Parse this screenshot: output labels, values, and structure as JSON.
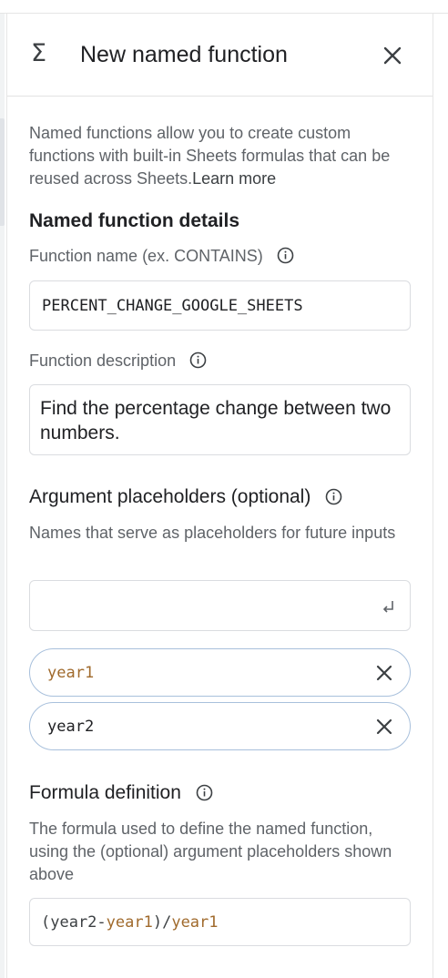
{
  "panel": {
    "title": "New named function",
    "intro_text": "Named functions allow you to create custom functions with built-in Sheets formulas that can be reused across Sheets.",
    "learn_more": "Learn more"
  },
  "details": {
    "section_title": "Named function details",
    "name_label": "Function name (ex. CONTAINS)",
    "name_value": "PERCENT_CHANGE_GOOGLE_SHEETS",
    "description_label": "Function description",
    "description_value": "Find the percentage change between two numbers."
  },
  "arguments": {
    "section_title": "Argument placeholders (optional)",
    "helper": "Names that serve as placeholders for future inputs",
    "input_value": "",
    "chips": [
      {
        "label": "year1"
      },
      {
        "label": "year2"
      }
    ]
  },
  "formula": {
    "section_title": "Formula definition",
    "helper": "The formula used to define the named function, using the (optional) argument placeholders shown above",
    "tokens": [
      "(year2-",
      "year1",
      ")/",
      "year1"
    ]
  },
  "icons": [
    "sigma-icon",
    "close-icon",
    "info-icon",
    "enter-icon",
    "chip-remove-icon"
  ],
  "colors": {
    "argument_token": "#a06a2c",
    "chip_border": "#a8c0dc",
    "field_border": "#dadce0"
  }
}
